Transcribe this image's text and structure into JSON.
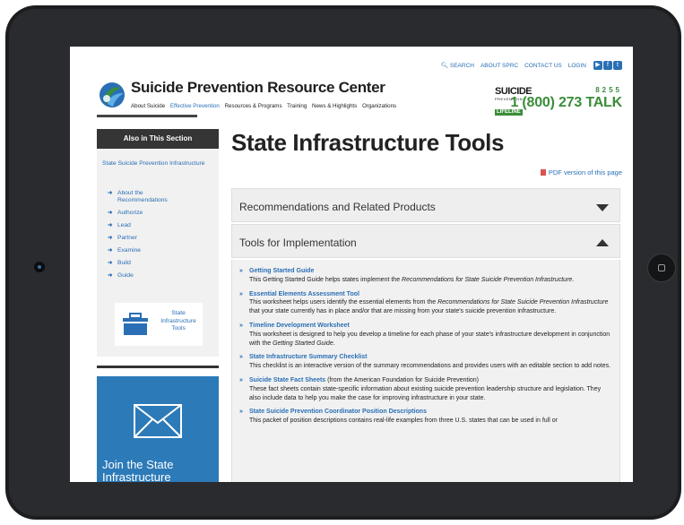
{
  "header": {
    "top_links": [
      "SEARCH",
      "ABOUT SPRC",
      "CONTACT US",
      "LOGIN"
    ],
    "social_icons": [
      "youtube-icon",
      "facebook-icon",
      "twitter-icon"
    ],
    "site_title": "Suicide Prevention Resource Center",
    "nav": [
      "About Suicide",
      "Effective Prevention",
      "Resources & Programs",
      "Training",
      "News & Highlights",
      "Organizations"
    ],
    "nav_active": "Effective Prevention",
    "lifeline": {
      "word1": "SUICIDE",
      "word2": "PREVENTION",
      "word3": "LIFELINE",
      "digits": "8255",
      "phone": "1 (800) 273 TALK"
    },
    "colors": {
      "link": "#2a6fb5",
      "lifeline_green": "#3a8d3a",
      "sidebar_dark": "#353535",
      "promo_blue": "#2c7ab8"
    }
  },
  "sidebar": {
    "heading": "Also in This Section",
    "parent_link": "State Suicide Prevention Infrastructure",
    "links": [
      "About the Recommendations",
      "Authorize",
      "Lead",
      "Partner",
      "Examine",
      "Build",
      "Guide"
    ],
    "tools_card_label": "State Infrastructure Tools",
    "promo_text": "Join the State Infrastructure"
  },
  "main": {
    "title": "State Infrastructure Tools",
    "pdf_link": "PDF version of this page",
    "accordion": [
      {
        "label": "Recommendations and Related Products",
        "state": "collapsed"
      },
      {
        "label": "Tools for Implementation",
        "state": "expanded"
      }
    ],
    "tools": [
      {
        "title": "Getting Started Guide",
        "source": "",
        "desc_pre": "This Getting Started Guide helps states implement the ",
        "desc_italic": "Recommendations for State Suicide Prevention Infrastructure",
        "desc_post": "."
      },
      {
        "title": "Essential Elements Assessment Tool",
        "source": "",
        "desc_pre": "This worksheet helps users identify the essential elements from the ",
        "desc_italic": "Recommendations for State Suicide Prevention Infrastructure",
        "desc_post": " that your state currently has in place and/or that are missing from your state's suicide prevention infrastructure."
      },
      {
        "title": "Timeline Development Worksheet",
        "source": "",
        "desc_pre": "This worksheet is designed to help you develop a timeline for each phase of your state's infrastructure development in conjunction with the ",
        "desc_italic": "Getting Started Guide",
        "desc_post": "."
      },
      {
        "title": "State Infrastructure Summary Checklist",
        "source": "",
        "desc_pre": "This checklist is an interactive version of the summary recommendations and provides users with an editable section to add notes.",
        "desc_italic": "",
        "desc_post": ""
      },
      {
        "title": "Suicide State Fact Sheets",
        "source": " (from the American Foundation for Suicide Prevention)",
        "desc_pre": "These fact sheets contain state-specific information about existing suicide prevention leadership structure and legislation. They also include data to help you make the case for improving infrastructure in your state.",
        "desc_italic": "",
        "desc_post": ""
      },
      {
        "title": "State Suicide Prevention Coordinator Position Descriptions",
        "source": "",
        "desc_pre": "This packet of position descriptions contains real-life examples from three U.S. states that can be used in full or",
        "desc_italic": "",
        "desc_post": ""
      }
    ]
  }
}
